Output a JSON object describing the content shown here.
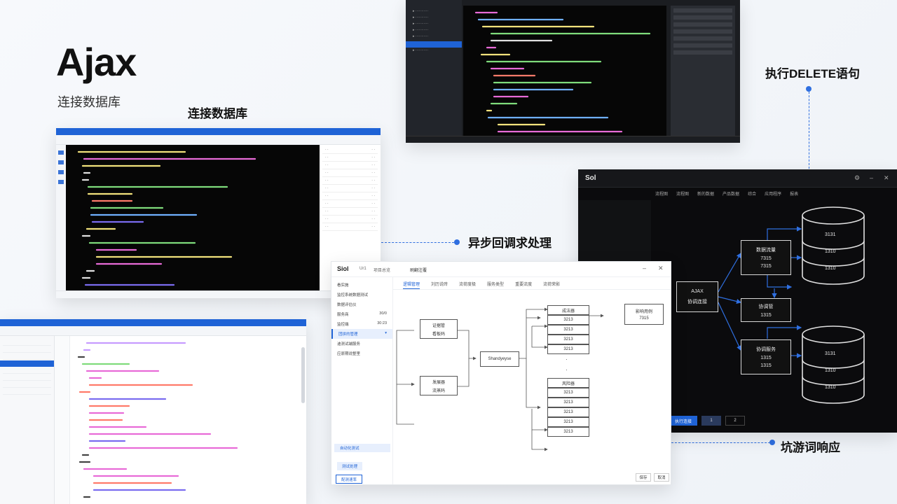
{
  "headline": {
    "title": "Ajax",
    "subtitle": "连接数据库"
  },
  "callouts": {
    "connect_db": "连接数据库",
    "async_callback": "异步回调求处理",
    "delete_stmt": "执行DELETE语句",
    "response": "坑游词响应"
  },
  "diagram_window": {
    "logo": "Siol",
    "top_links": [
      "Ur1",
      "项目总览"
    ],
    "title": "刷翻注覆",
    "tabs": [
      "逻辑管理",
      "刘历说砖",
      "流荷度极",
      "服务类型",
      "重要流度",
      "流荷荣影"
    ],
    "sidebar": [
      "看实施",
      "监控系统数据测试",
      "数据评估仪",
      "服务商",
      "监控端",
      "团拼的管理",
      "迪测试端服务",
      "应原期说整里"
    ],
    "sidebar_values": [
      "",
      "",
      "",
      "30/0",
      "30:23",
      "",
      "",
      ""
    ],
    "sidebar_bottom": "自动化测试",
    "btn_primary": "测试处理",
    "btn_secondary": "配测速率",
    "footer_buttons": [
      "保存",
      "取消"
    ],
    "nodes_left": [
      "证据管",
      "看板码",
      "发展器",
      "流蒸码"
    ],
    "node_center": "Shandyeyse",
    "column_top_head": "成法器",
    "column_top": [
      "3213",
      "3213",
      "3213",
      "3213"
    ],
    "column_bottom_head": "风险器",
    "column_bottom": [
      "3213",
      "3213",
      "3213",
      "3213",
      "3213"
    ],
    "node_right": [
      "影响用例",
      "7315"
    ]
  },
  "dark_diagram": {
    "logo": "Sol",
    "tabs": [
      "流程图",
      "流程图",
      "新的数据",
      "产品数据",
      "综合",
      "应用程序",
      "报表"
    ],
    "left_node": [
      "AJAX",
      "协调连接"
    ],
    "mid_top": [
      "数据流量",
      "7315",
      "7315"
    ],
    "mid_center": [
      "协调管",
      "1315"
    ],
    "mid_bottom": [
      "协调服务",
      "1315",
      "1315"
    ],
    "db_top": [
      "3131",
      "1310",
      "1310"
    ],
    "db_bottom": [
      "3131",
      "1310",
      "1310"
    ],
    "buttons": [
      "执行连接",
      "1",
      "2"
    ]
  },
  "colors": {
    "accent": "#2f6fe0",
    "brand_bar": "#1f63d6",
    "dark_bg": "#0b0b0d"
  }
}
